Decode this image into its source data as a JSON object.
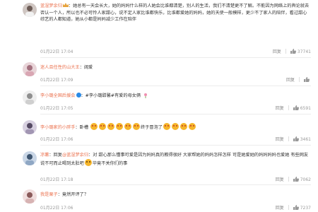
{
  "comments": [
    {
      "username": "蓝湿梦余归",
      "badge": "gold",
      "text": "：她总有一天会长大，她的妈妈什么样的人她会比谁都清楚，别人的生活，我们不清楚更不了解。不能因为网络上的舆论就去否认一个人，所以也不必可怜人家甜心，说不定人家比谁都快乐，比谁都爱她的妈妈，她的天使一般模样，更少不了家人的陪伴，看过甜心综艺的人都知道，她从小都是妈妈减少工作在陪伴",
      "time": "01月22日 17:04",
      "report": "回复",
      "likes": "37741"
    },
    {
      "username": "迷人且任性的山大王",
      "badge": "",
      "text": "：阔爱",
      "time": "01月22日 17:09",
      "report": "回复",
      "likes": ""
    },
    {
      "username": "李小璐全国后援会",
      "badge": "blue",
      "text": "：#李小璐甜馨#有爱的母女俩",
      "time": "01月22日 17:05",
      "report": "回复",
      "likes": "6591"
    },
    {
      "username": "李小璐家的小胖手",
      "badge": "",
      "text": "：卧槽",
      "text_after": "终于冒泡了",
      "time": "01月22日 17:06",
      "report": "回复",
      "likes": "3461"
    },
    {
      "username": "凉薯",
      "badge": "",
      "text": "：回复",
      "mention": "@蓝湿梦余归",
      "text_rest": "：对 甜心那么懂事可爱是因为妈妈真的教得很好 大家帮她的妈妈怎样怎样 可是她爱她的妈妈妈妈也爱她 有些网友说不可而止喝到太肚吧",
      "text_after": "毕竟不关你们的事",
      "time": "01月22日 17:18",
      "report": "回复",
      "likes": "7062"
    },
    {
      "username": "我是栗子",
      "badge": "",
      "text": "：竟然开评了？",
      "time": "01月22日 17:06",
      "report": "回复",
      "likes": "7237"
    }
  ],
  "colors": {
    "username": "#eb7350",
    "text": "#333333",
    "meta": "#999999",
    "emoji": "#f5b52a"
  },
  "icons": {
    "like": "thumbs-up-icon",
    "emoji": "smiley-face-icon",
    "flower": "flower-icon",
    "verified": "verified-badge-icon"
  }
}
